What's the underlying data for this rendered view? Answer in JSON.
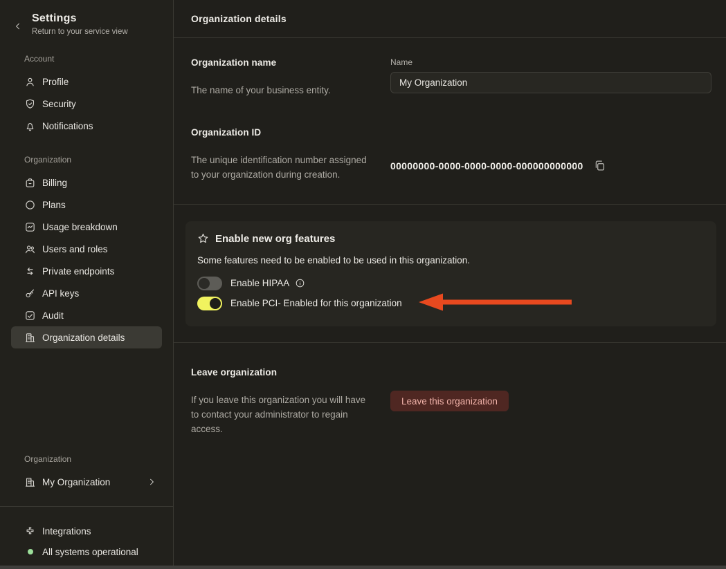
{
  "sidebar": {
    "title": "Settings",
    "subtitle": "Return to your service view",
    "sections": [
      {
        "label": "Account",
        "items": [
          {
            "icon": "user",
            "label": "Profile"
          },
          {
            "icon": "shield",
            "label": "Security"
          },
          {
            "icon": "bell",
            "label": "Notifications"
          }
        ]
      },
      {
        "label": "Organization",
        "items": [
          {
            "icon": "billing",
            "label": "Billing"
          },
          {
            "icon": "circle",
            "label": "Plans"
          },
          {
            "icon": "chart",
            "label": "Usage breakdown"
          },
          {
            "icon": "users",
            "label": "Users and roles"
          },
          {
            "icon": "arrows",
            "label": "Private endpoints"
          },
          {
            "icon": "key",
            "label": "API keys"
          },
          {
            "icon": "audit",
            "label": "Audit"
          },
          {
            "icon": "building",
            "label": "Organization details",
            "selected": true
          }
        ]
      }
    ],
    "org_switcher": {
      "label": "Organization",
      "name": "My Organization",
      "icon": "building"
    },
    "footer": {
      "integrations_label": "Integrations",
      "status_label": "All systems operational",
      "status_color": "#9cdf9a"
    }
  },
  "main": {
    "header_title": "Organization details",
    "org_name": {
      "title": "Organization name",
      "description": "The name of your business entity.",
      "field_label": "Name",
      "field_value": "My Organization"
    },
    "org_id": {
      "title": "Organization ID",
      "description": "The unique identification number assigned to your organization during creation.",
      "value": "00000000-0000-0000-0000-000000000000"
    },
    "features_card": {
      "title": "Enable new org features",
      "description": "Some features need to be enabled to be used in this organization.",
      "toggles": [
        {
          "label": "Enable HIPAA",
          "state": "off",
          "info": true
        },
        {
          "label": "Enable PCI- Enabled for this organization",
          "state": "on",
          "arrow": true
        }
      ],
      "toggle_on_color": "#f1f35f",
      "arrow_color": "#e8491f"
    },
    "leave": {
      "title": "Leave organization",
      "description": "If you leave this organization you will have to contact your administrator to regain access.",
      "button_label": "Leave this organization"
    }
  }
}
